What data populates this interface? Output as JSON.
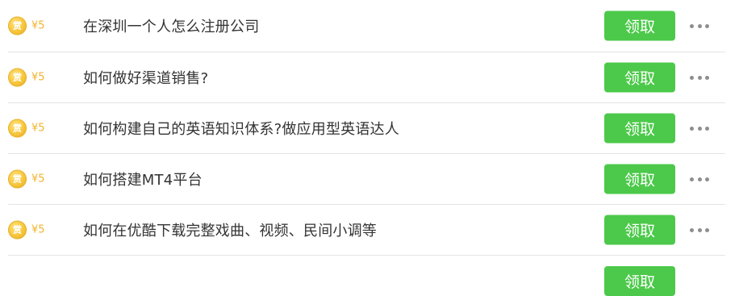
{
  "currency_symbol": "¥",
  "coin_glyph": "赏",
  "claim_label": "领取",
  "colors": {
    "accent_green": "#4cc94a",
    "coin_gold": "#f6c43a",
    "amount_text": "#f0b32e",
    "title_text": "#333333",
    "divider": "#e4e4e4"
  },
  "items": [
    {
      "amount": "¥5",
      "title": "在深圳一个人怎么注册公司"
    },
    {
      "amount": "¥5",
      "title": "如何做好渠道销售?"
    },
    {
      "amount": "¥5",
      "title": "如何构建自己的英语知识体系?做应用型英语达人"
    },
    {
      "amount": "¥5",
      "title": "如何搭建MT4平台"
    },
    {
      "amount": "¥5",
      "title": "如何在优酷下载完整戏曲、视频、民间小调等"
    }
  ],
  "icons": {
    "coin": "reward-coin-icon",
    "more": "more-options-icon"
  }
}
